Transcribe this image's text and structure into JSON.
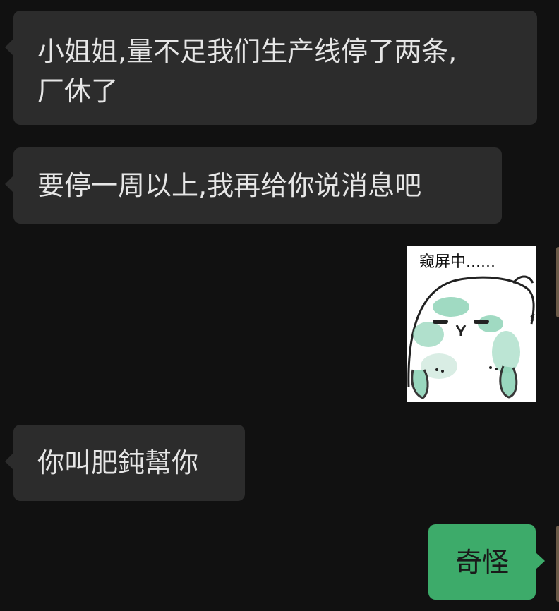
{
  "messages": [
    {
      "id": "m1",
      "direction": "incoming",
      "text": "小姐姐,量不足我们生产线停了两条,\n厂休了"
    },
    {
      "id": "m2",
      "direction": "incoming",
      "text": "要停一周以上,我再给你说消息吧"
    },
    {
      "id": "m3",
      "direction": "outgoing",
      "type": "sticker",
      "caption": "窥屏中......",
      "icon": "peeking-seal-sticker"
    },
    {
      "id": "m4",
      "direction": "incoming",
      "text": "你叫肥鈍幫你"
    },
    {
      "id": "m5",
      "direction": "outgoing",
      "text": "奇怪"
    }
  ],
  "colors": {
    "background": "#111111",
    "incoming_bubble": "#2c2c2c",
    "outgoing_bubble": "#3dab6a",
    "incoming_text": "#e6e6e6",
    "outgoing_text": "#1a1a1a"
  }
}
